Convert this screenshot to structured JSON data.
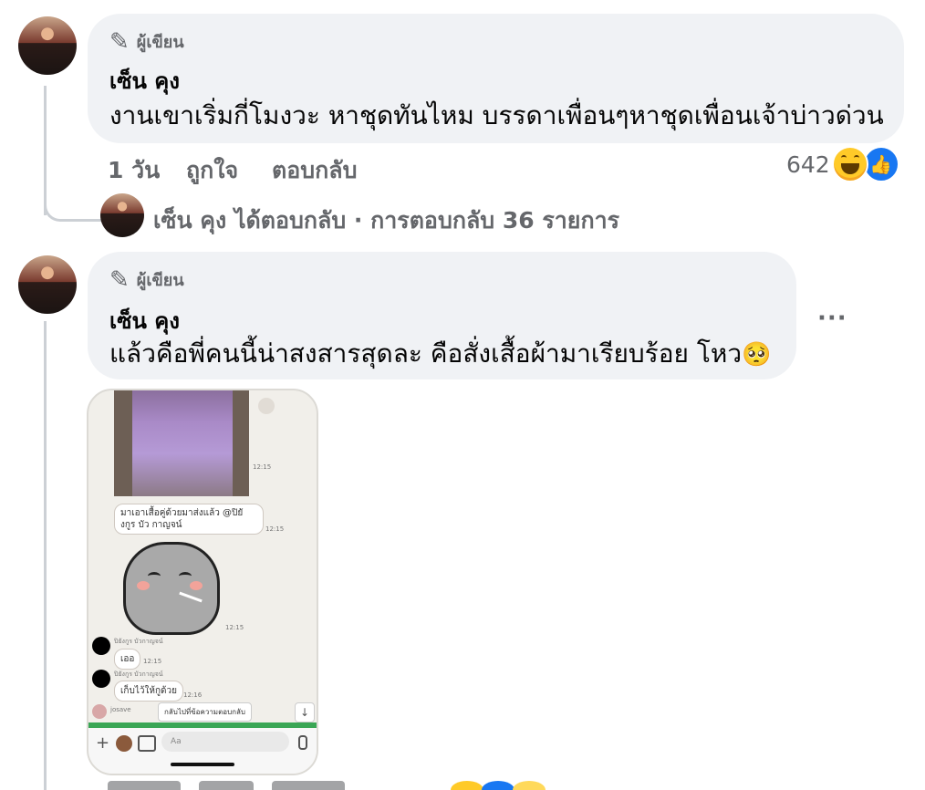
{
  "comments": [
    {
      "badge": "ผู้เขียน",
      "author": "เซ็น คุง",
      "text": "งานเขาเริ่มกี่โมงวะ หาชุดทันไหม บรรดาเพื่อนๆหาชุดเพื่อนเจ้าบ่าวด่วน",
      "time": "1 วัน",
      "like_label": "ถูกใจ",
      "reply_label": "ตอบกลับ",
      "reaction_count": "642",
      "reply_summary": "เซ็น คุง ได้ตอบกลับ · การตอบกลับ 36 รายการ"
    },
    {
      "badge": "ผู้เขียน",
      "author": "เซ็น คุง",
      "text": "แล้วคือพี่คนนี้น่าสงสารสุดละ คือสั่งเสื้อผ้ามาเรียบร้อย โหว",
      "emoji": "🥺",
      "more": "···",
      "screenshot": {
        "message1": "มาเอาเสื้อคู่ด้วยมาส่งแล้ว @ปิยังกูร บัว กาญจน์",
        "time1": "12:15",
        "time2": "12:15",
        "time3": "12:15",
        "user1": "ปิยังกูร บัวกาญจน์",
        "reply1": "เออ",
        "time4": "12:15",
        "user2": "ปิยังกูร บัวกาญจน์",
        "reply2": "เก็บไว้ให้กูด้วย",
        "time5": "12:16",
        "user3": "josave",
        "jump_label": "กลับไปที่ข้อความตอบกลับ",
        "input_placeholder": "Aa"
      }
    }
  ],
  "colors": {
    "bubble_bg": "#f0f2f5",
    "meta_text": "#65676b",
    "like_blue": "#1877f2",
    "haha_yellow": "#ffca28"
  }
}
